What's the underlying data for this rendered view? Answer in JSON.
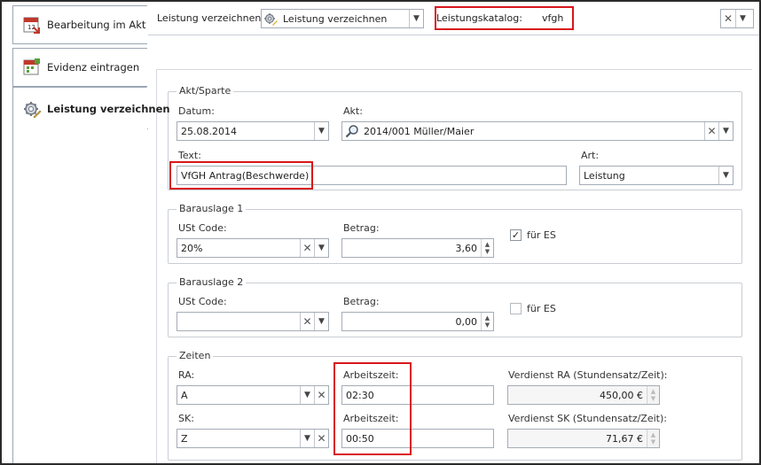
{
  "nav": {
    "items": [
      {
        "label": "Bearbeitung im Akt",
        "icon": "calendar-icon"
      },
      {
        "label": "Evidenz eintragen",
        "icon": "calendar-add-icon"
      },
      {
        "label": "Leistung verzeichnen",
        "icon": "gear-pencil-icon"
      }
    ]
  },
  "toolbar": {
    "leistung_label": "Leistung verzeichnen:",
    "leistung_value": "Leistung verzeichnen",
    "katalog_label": "Leistungskatalog:",
    "katalog_value": "vfgh"
  },
  "akt_sparte": {
    "title": "Akt/Sparte",
    "datum_label": "Datum:",
    "datum_value": "25.08.2014",
    "akt_label": "Akt:",
    "akt_value": "2014/001 Müller/Maier",
    "text_label": "Text:",
    "text_value": "VfGH Antrag(Beschwerde)",
    "art_label": "Art:",
    "art_value": "Leistung"
  },
  "barauslage1": {
    "title": "Barauslage 1",
    "ust_label": "USt Code:",
    "ust_value": "20%",
    "betrag_label": "Betrag:",
    "betrag_value": "3,60",
    "fuer_es_label": "für ES",
    "fuer_es_checked": "✓"
  },
  "barauslage2": {
    "title": "Barauslage 2",
    "ust_label": "USt Code:",
    "ust_value": "",
    "betrag_label": "Betrag:",
    "betrag_value": "0,00",
    "fuer_es_label": "für ES",
    "fuer_es_checked": ""
  },
  "zeiten": {
    "title": "Zeiten",
    "ra_label": "RA:",
    "ra_value": "A",
    "ra_arbeitszeit_label": "Arbeitszeit:",
    "ra_arbeitszeit_value": "02:30",
    "ra_verdienst_label": "Verdienst RA (Stundensatz/Zeit):",
    "ra_verdienst_value": "450,00 €",
    "sk_label": "SK:",
    "sk_value": "Z",
    "sk_arbeitszeit_label": "Arbeitszeit:",
    "sk_arbeitszeit_value": "00:50",
    "sk_verdienst_label": "Verdienst SK (Stundensatz/Zeit):",
    "sk_verdienst_value": "71,67 €"
  },
  "colors": {
    "highlight": "#d9161c",
    "border": "#a5acb5"
  }
}
